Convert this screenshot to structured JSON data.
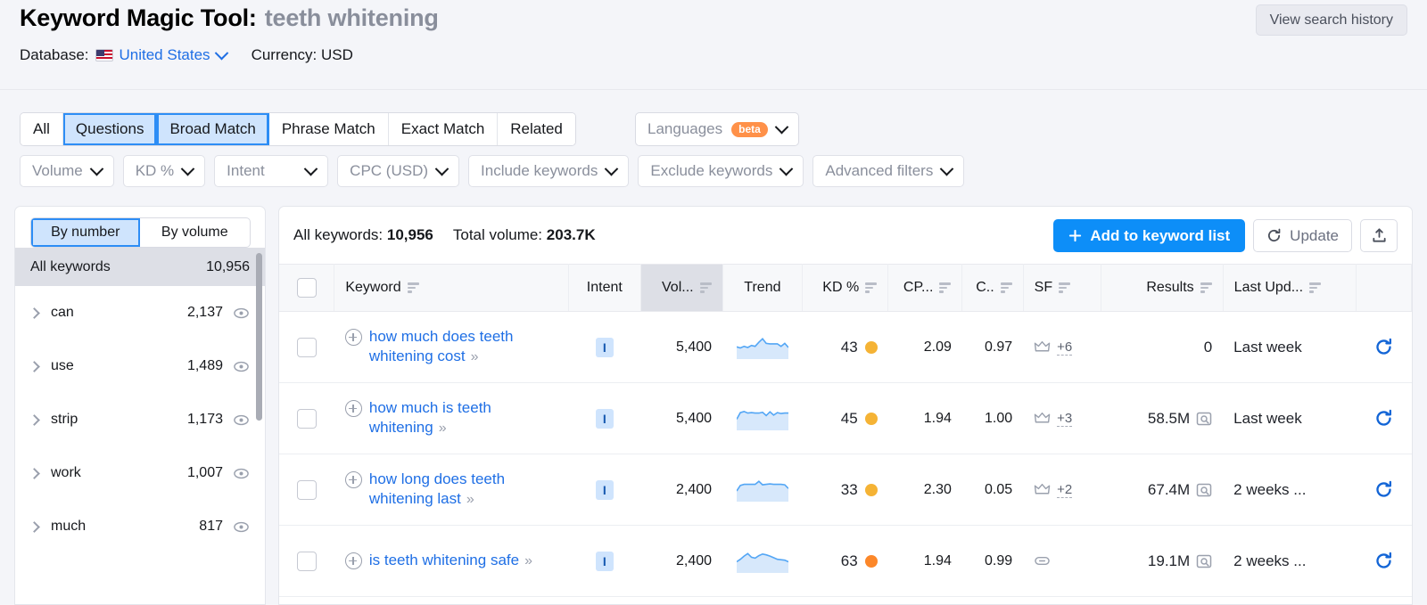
{
  "header": {
    "title_main": "Keyword Magic Tool:",
    "title_term": "teeth whitening",
    "database_label": "Database:",
    "database_value": "United States",
    "currency_label": "Currency: USD",
    "view_history_label": "View search history"
  },
  "filters": {
    "match_tabs": [
      {
        "label": "All",
        "active": false
      },
      {
        "label": "Questions",
        "active": true
      },
      {
        "label": "Broad Match",
        "active": true
      },
      {
        "label": "Phrase Match",
        "active": false
      },
      {
        "label": "Exact Match",
        "active": false
      },
      {
        "label": "Related",
        "active": false
      }
    ],
    "languages_label": "Languages",
    "languages_badge": "beta",
    "dropdowns": [
      {
        "label": "Volume"
      },
      {
        "label": "KD %"
      },
      {
        "label": "Intent"
      },
      {
        "label": "CPC (USD)"
      },
      {
        "label": "Include keywords"
      },
      {
        "label": "Exclude keywords"
      },
      {
        "label": "Advanced filters"
      }
    ]
  },
  "sidebar": {
    "segmented": [
      {
        "label": "By number",
        "active": true
      },
      {
        "label": "By volume",
        "active": false
      }
    ],
    "all_keywords_label": "All keywords",
    "all_keywords_count": "10,956",
    "groups": [
      {
        "label": "can",
        "count": "2,137"
      },
      {
        "label": "use",
        "count": "1,489"
      },
      {
        "label": "strip",
        "count": "1,173"
      },
      {
        "label": "work",
        "count": "1,007"
      },
      {
        "label": "much",
        "count": "817"
      }
    ]
  },
  "main": {
    "summary_keywords_label": "All keywords:",
    "summary_keywords_value": "10,956",
    "summary_volume_label": "Total volume:",
    "summary_volume_value": "203.7K",
    "add_to_list_label": "Add to keyword list",
    "update_label": "Update",
    "columns": [
      {
        "key": "keyword",
        "label": "Keyword",
        "sortable": true
      },
      {
        "key": "intent",
        "label": "Intent",
        "sortable": false
      },
      {
        "key": "volume",
        "label": "Vol...",
        "sortable": true,
        "active": true
      },
      {
        "key": "trend",
        "label": "Trend",
        "sortable": false
      },
      {
        "key": "kd",
        "label": "KD %",
        "sortable": true
      },
      {
        "key": "cpc",
        "label": "CP...",
        "sortable": true
      },
      {
        "key": "com",
        "label": "C..",
        "sortable": true
      },
      {
        "key": "sf",
        "label": "SF",
        "sortable": true
      },
      {
        "key": "results",
        "label": "Results",
        "sortable": true
      },
      {
        "key": "updated",
        "label": "Last Upd...",
        "sortable": true
      }
    ],
    "rows": [
      {
        "keyword": "how much does teeth whitening cost",
        "intent": "I",
        "volume": "5,400",
        "trend": [
          0.55,
          0.5,
          0.58,
          0.52,
          0.62,
          0.58,
          0.78,
          0.95,
          0.72,
          0.7,
          0.7,
          0.7,
          0.58,
          0.72,
          0.52
        ],
        "kd": "43",
        "kd_color": "#f5b335",
        "cpc": "2.09",
        "com": "0.97",
        "sf_icon": "crown-icon",
        "sf_extra": "+6",
        "results": "0",
        "results_icon": false,
        "updated": "Last week"
      },
      {
        "keyword": "how much is teeth whitening",
        "intent": "I",
        "volume": "5,400",
        "trend": [
          0.5,
          0.82,
          0.88,
          0.8,
          0.82,
          0.8,
          0.8,
          0.84,
          0.68,
          0.86,
          0.7,
          0.82,
          0.78,
          0.8,
          0.8
        ],
        "kd": "45",
        "kd_color": "#f5b335",
        "cpc": "1.94",
        "com": "1.00",
        "sf_icon": "crown-icon",
        "sf_extra": "+3",
        "results": "58.5M",
        "results_icon": true,
        "updated": "Last week"
      },
      {
        "keyword": "how long does teeth whitening last",
        "intent": "I",
        "volume": "2,400",
        "trend": [
          0.48,
          0.75,
          0.8,
          0.8,
          0.8,
          0.8,
          0.95,
          0.78,
          0.8,
          0.82,
          0.8,
          0.8,
          0.8,
          0.78,
          0.6
        ],
        "kd": "33",
        "kd_color": "#f5b335",
        "cpc": "2.30",
        "com": "0.05",
        "sf_icon": "crown-icon",
        "sf_extra": "+2",
        "results": "67.4M",
        "results_icon": true,
        "updated": "2 weeks ..."
      },
      {
        "keyword": "is teeth whitening safe",
        "intent": "I",
        "volume": "2,400",
        "trend": [
          0.5,
          0.62,
          0.78,
          0.9,
          0.72,
          0.68,
          0.8,
          0.88,
          0.84,
          0.78,
          0.7,
          0.62,
          0.6,
          0.58,
          0.5
        ],
        "kd": "63",
        "kd_color": "#fc8729",
        "cpc": "1.94",
        "com": "0.99",
        "sf_icon": "link-icon",
        "sf_extra": "",
        "results": "19.1M",
        "results_icon": true,
        "updated": "2 weeks ..."
      }
    ]
  },
  "colors": {
    "accent": "#0d8ef8",
    "link": "#1f6fe5",
    "selected_bg": "#cfe4fd",
    "beta_badge": "#ff9149"
  }
}
